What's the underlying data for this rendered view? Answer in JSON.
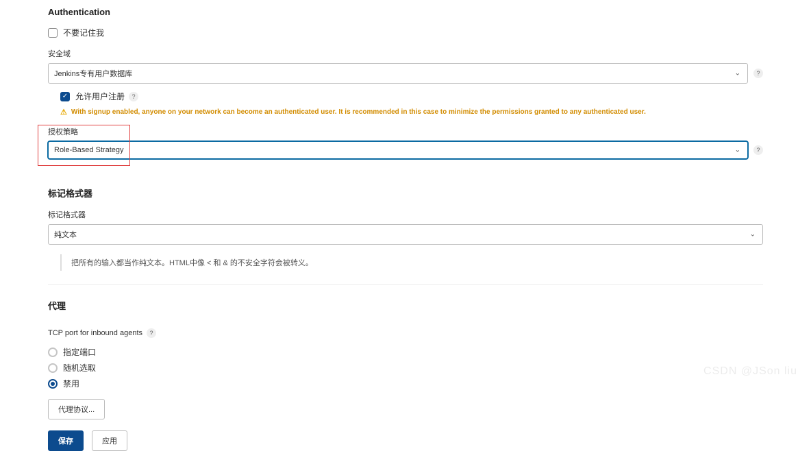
{
  "auth": {
    "heading": "Authentication",
    "remember_label": "不要记住我",
    "realm_label": "安全域",
    "realm_value": "Jenkins专有用户数据库",
    "allow_signup_label": "允许用户注册",
    "signup_warning": "With signup enabled, anyone on your network can become an authenticated user. It is recommended in this case to minimize the permissions granted to any authenticated user.",
    "authz_label": "授权策略",
    "authz_value": "Role-Based Strategy"
  },
  "formatter": {
    "heading": "标记格式器",
    "label": "标记格式器",
    "value": "纯文本",
    "note": "把所有的输入都当作纯文本。HTML中像 < 和 & 的不安全字符会被转义。"
  },
  "agent": {
    "heading": "代理",
    "tcp_label": "TCP port for inbound agents",
    "radio_fixed": "指定端口",
    "radio_random": "随机选取",
    "radio_disable": "禁用",
    "protocol_btn": "代理协议...",
    "save": "保存",
    "apply": "应用"
  },
  "watermark": "CSDN @JSon  liu"
}
